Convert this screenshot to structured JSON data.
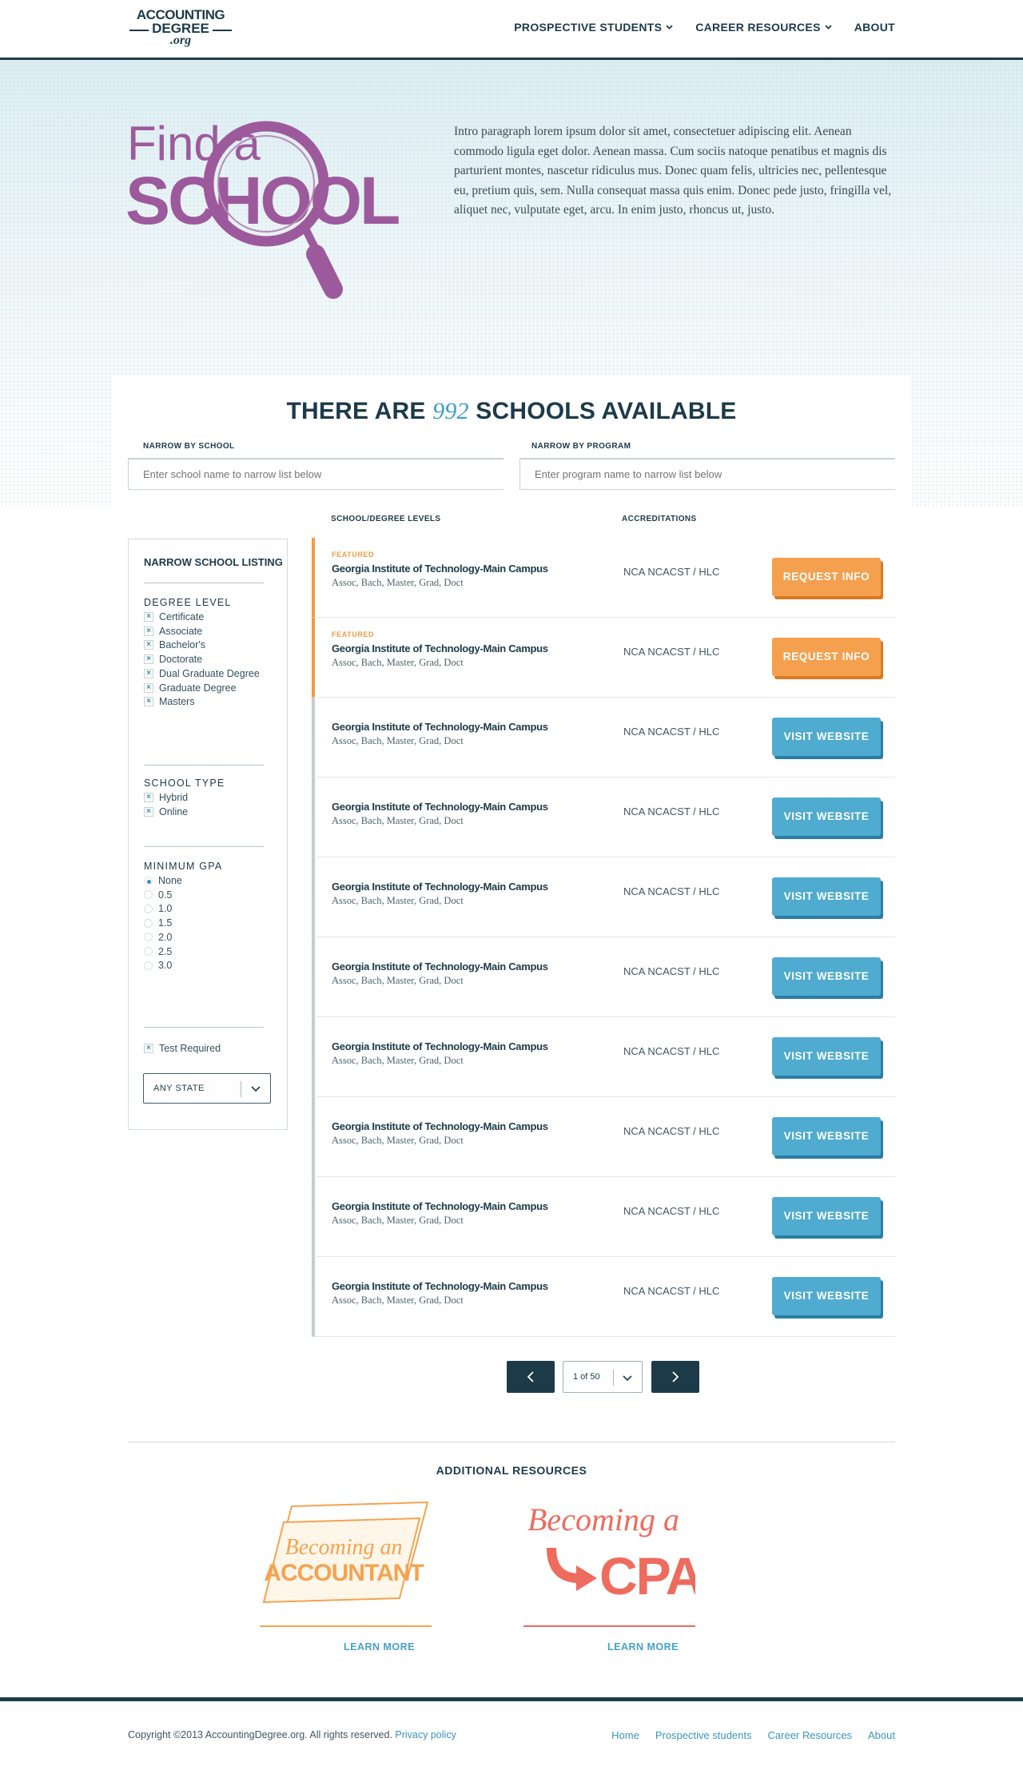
{
  "header": {
    "logo": {
      "line1": "ACCOUNTING",
      "line2": "DEGREE",
      "line3": ".org"
    },
    "nav": [
      {
        "label": "PROSPECTIVE STUDENTS",
        "has_dropdown": true
      },
      {
        "label": "CAREER RESOURCES",
        "has_dropdown": true
      },
      {
        "label": "ABOUT",
        "has_dropdown": false
      }
    ]
  },
  "hero": {
    "title_line1": "Find a",
    "title_line2": "SCHOOL",
    "intro": "Intro paragraph lorem ipsum dolor sit amet, consectetuer adipiscing elit. Aenean commodo ligula eget dolor. Aenean massa. Cum sociis natoque penatibus et magnis dis parturient montes, nascetur ridiculus mus. Donec quam felis, ultricies nec, pellentesque eu, pretium quis, sem. Nulla consequat massa quis enim. Donec pede justo, fringilla vel, aliquet nec, vulputate eget, arcu. In enim justo, rhoncus ut, justo."
  },
  "listing": {
    "title_prefix": "THERE ARE",
    "count": "992",
    "title_suffix": "SCHOOLS AVAILABLE",
    "narrow_school_label": "NARROW BY SCHOOL",
    "narrow_school_placeholder": "Enter school name to narrow list below",
    "narrow_program_label": "NARROW BY PROGRAM",
    "narrow_program_placeholder": "Enter program name to narrow list below",
    "col_school": "SCHOOL/DEGREE LEVELS",
    "col_accreditations": "ACCREDITATIONS"
  },
  "sidebar": {
    "title": "NARROW SCHOOL LISTING",
    "degree_heading": "DEGREE LEVEL",
    "degree_options": [
      "Certificate",
      "Associate",
      "Bachelor's",
      "Doctorate",
      "Dual Graduate Degree",
      "Graduate Degree",
      "Masters"
    ],
    "type_heading": "SCHOOL TYPE",
    "type_options": [
      "Hybrid",
      "Online"
    ],
    "gpa_heading": "MINIMUM GPA",
    "gpa_options": [
      "None",
      "0.5",
      "1.0",
      "1.5",
      "2.0",
      "2.5",
      "3.0"
    ],
    "gpa_selected": "None",
    "check_mark": "×",
    "test_required": "Test Required",
    "state_select": "ANY STATE"
  },
  "schools": [
    {
      "featured": true,
      "featured_label": "FEATURED",
      "name": "Georgia Institute of Technology-Main Campus",
      "degrees": "Assoc, Bach, Master, Grad, Doct",
      "accreditation": "NCA NCACST / HLC",
      "button": "REQUEST INFO"
    },
    {
      "featured": true,
      "featured_label": "FEATURED",
      "name": "Georgia Institute of Technology-Main Campus",
      "degrees": "Assoc, Bach, Master, Grad, Doct",
      "accreditation": "NCA NCACST / HLC",
      "button": "REQUEST INFO"
    },
    {
      "featured": false,
      "name": "Georgia Institute of Technology-Main Campus",
      "degrees": "Assoc, Bach, Master, Grad, Doct",
      "accreditation": "NCA NCACST / HLC",
      "button": "VISIT WEBSITE"
    },
    {
      "featured": false,
      "name": "Georgia Institute of Technology-Main Campus",
      "degrees": "Assoc, Bach, Master, Grad, Doct",
      "accreditation": "NCA NCACST / HLC",
      "button": "VISIT WEBSITE"
    },
    {
      "featured": false,
      "name": "Georgia Institute of Technology-Main Campus",
      "degrees": "Assoc, Bach, Master, Grad, Doct",
      "accreditation": "NCA NCACST / HLC",
      "button": "VISIT WEBSITE"
    },
    {
      "featured": false,
      "name": "Georgia Institute of Technology-Main Campus",
      "degrees": "Assoc, Bach, Master, Grad, Doct",
      "accreditation": "NCA NCACST / HLC",
      "button": "VISIT WEBSITE"
    },
    {
      "featured": false,
      "name": "Georgia Institute of Technology-Main Campus",
      "degrees": "Assoc, Bach, Master, Grad, Doct",
      "accreditation": "NCA NCACST / HLC",
      "button": "VISIT WEBSITE"
    },
    {
      "featured": false,
      "name": "Georgia Institute of Technology-Main Campus",
      "degrees": "Assoc, Bach, Master, Grad, Doct",
      "accreditation": "NCA NCACST / HLC",
      "button": "VISIT WEBSITE"
    },
    {
      "featured": false,
      "name": "Georgia Institute of Technology-Main Campus",
      "degrees": "Assoc, Bach, Master, Grad, Doct",
      "accreditation": "NCA NCACST / HLC",
      "button": "VISIT WEBSITE"
    },
    {
      "featured": false,
      "name": "Georgia Institute of Technology-Main Campus",
      "degrees": "Assoc, Bach, Master, Grad, Doct",
      "accreditation": "NCA NCACST / HLC",
      "button": "VISIT WEBSITE"
    }
  ],
  "pagination": {
    "current": "1 of 50",
    "prev_icon": "chevron-left-icon",
    "next_icon": "chevron-right-icon"
  },
  "resources": {
    "title": "ADDITIONAL RESOURCES",
    "cards": [
      {
        "line1": "Becoming an",
        "line2": "ACCOUNTANT",
        "link": "LEARN MORE",
        "color": "#f5a34f"
      },
      {
        "line1": "Becoming a",
        "line2": "CPA",
        "link": "LEARN MORE",
        "color": "#ee6b5e"
      }
    ]
  },
  "footer": {
    "copyright": "Copyright ©2013 AccountingDegree.org. All rights reserved.",
    "privacy": "Privacy policy",
    "links": [
      "Home",
      "Prospective students",
      "Career Resources",
      "About"
    ]
  },
  "colors": {
    "navy": "#1d3a49",
    "accent_blue": "#4fabcf",
    "accent_orange": "#f5a04f",
    "hero_purple": "#9c5a9c"
  }
}
